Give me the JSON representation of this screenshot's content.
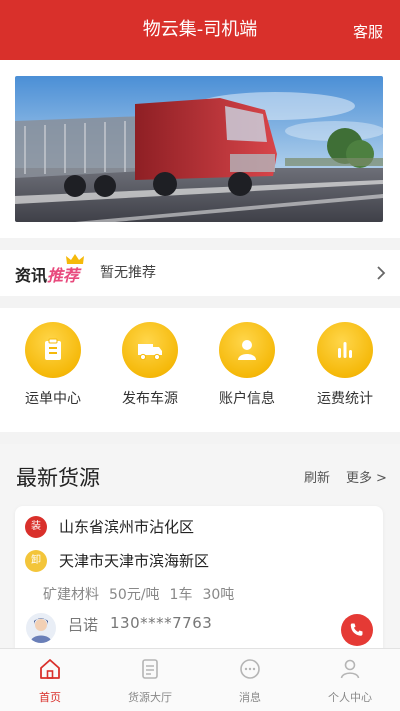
{
  "header": {
    "title": "物云集-司机端",
    "service_label": "客服"
  },
  "news": {
    "logo_part1": "资讯",
    "logo_part2": "推荐",
    "text": "暂无推荐"
  },
  "quick_menu": [
    {
      "label": "运单中心",
      "icon": "document-icon"
    },
    {
      "label": "发布车源",
      "icon": "truck-icon"
    },
    {
      "label": "账户信息",
      "icon": "user-icon"
    },
    {
      "label": "运费统计",
      "icon": "bar-chart-icon"
    }
  ],
  "cargo": {
    "title": "最新货源",
    "refresh_label": "刷新",
    "more_label": "更多",
    "item": {
      "load_badge": "装",
      "load_addr": "山东省滨州市沾化区",
      "unload_badge": "卸",
      "unload_addr": "天津市天津市滨海新区",
      "goods": "矿建材料",
      "price": "50元/吨",
      "trucks": "1车",
      "weight": "30吨",
      "owner": "吕诺",
      "phone": "130****7763"
    }
  },
  "tabs": [
    {
      "label": "首页",
      "active": true
    },
    {
      "label": "货源大厅",
      "active": false
    },
    {
      "label": "消息",
      "active": false
    },
    {
      "label": "个人中心",
      "active": false
    }
  ],
  "colors": {
    "brand_red": "#d9302b",
    "accent_yellow": "#f5b90a"
  }
}
